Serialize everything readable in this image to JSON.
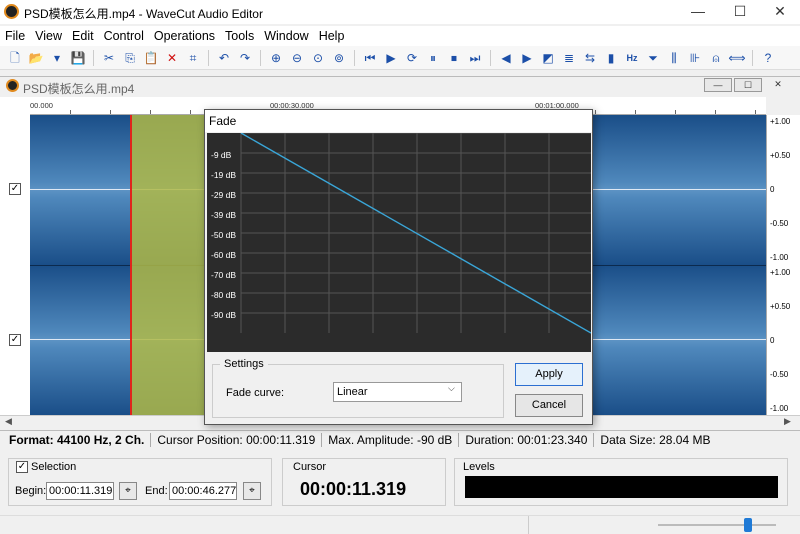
{
  "app": {
    "title": "PSD模板怎么用.mp4 - WaveCut Audio Editor"
  },
  "window_controls": {
    "minimize": "—",
    "maximize": "☐",
    "close": "✕"
  },
  "menu": [
    "File",
    "View",
    "Edit",
    "Control",
    "Operations",
    "Tools",
    "Window",
    "Help"
  ],
  "toolbar": {
    "icons": [
      "new-file-icon",
      "open-folder-icon",
      "dropdown-icon",
      "save-icon",
      "cut-icon",
      "copy-icon",
      "paste-icon",
      "delete-icon",
      "crop-icon",
      "undo-icon",
      "redo-icon",
      "zoom-in-icon",
      "zoom-out-icon",
      "zoom-selection-icon",
      "zoom-full-icon",
      "go-start-icon",
      "play-icon",
      "loop-icon",
      "pause-icon",
      "stop-icon",
      "go-end-icon",
      "rewind-icon",
      "forward-icon",
      "fade-icon",
      "normalize-icon",
      "reverse-icon",
      "levels-icon",
      "frequency-icon",
      "filter-icon",
      "equalizer-icon",
      "noise-icon",
      "amplitude-icon",
      "split-icon",
      "help-icon"
    ],
    "glyphs": [
      "🗋",
      "📂",
      "▾",
      "💾",
      "✂",
      "⎘",
      "📋",
      "✕",
      "⌗",
      "↶",
      "↷",
      "⊕",
      "⊖",
      "⊙",
      "⊚",
      "⏮",
      "▶",
      "⟳",
      "⏸",
      "⏹",
      "⏭",
      "◀",
      "▶",
      "◩",
      "≣",
      "⇆",
      "▮",
      "Hz",
      "⏷",
      "⫼",
      "⊪",
      "⍝",
      "⟺",
      "?"
    ]
  },
  "document": {
    "title": "PSD模板怎么用.mp4",
    "ruler_labels": [
      "00.000",
      "00:00:30.000",
      "00:01:00.000"
    ],
    "scale_labels": [
      "+1.00",
      "+0.50",
      "0",
      "-0.50",
      "-1.00",
      "+1.00",
      "+0.50",
      "0",
      "-0.50",
      "-1.00"
    ],
    "channel_checks": [
      "✓",
      "✓"
    ]
  },
  "status": {
    "format": "Format: 44100 Hz, 2 Ch.",
    "cursor_position": "Cursor Position: 00:00:11.319",
    "max_amplitude": "Max. Amplitude: -90 dB",
    "duration": "Duration: 00:01:23.340",
    "data_size": "Data Size: 28.04 MB"
  },
  "selection": {
    "label": "Selection",
    "checked": "✓",
    "begin_label": "Begin:",
    "begin_value": "00:00:11.319",
    "end_label": "End:",
    "end_value": "00:00:46.277"
  },
  "cursor": {
    "label": "Cursor",
    "value": "00:00:11.319"
  },
  "levels": {
    "label": "Levels"
  },
  "fade_dialog": {
    "title": "Fade",
    "db_labels": [
      "-9 dB",
      "-19 dB",
      "-29 dB",
      "-39 dB",
      "-50 dB",
      "-60 dB",
      "-70 dB",
      "-80 dB",
      "-90 dB"
    ],
    "settings_label": "Settings",
    "curve_label": "Fade curve:",
    "curve_value": "Linear",
    "apply_label": "Apply",
    "cancel_label": "Cancel",
    "curve_color": "#3aa6d8"
  },
  "colors": {
    "wave": "#1a4e88",
    "selection": "#afb946",
    "cursor": "#e0241c"
  }
}
